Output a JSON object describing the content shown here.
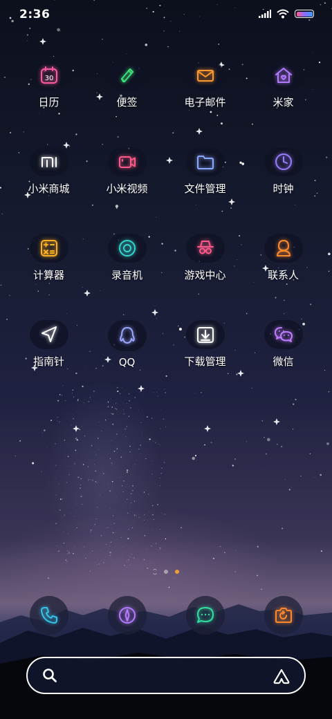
{
  "status_bar": {
    "time": "2:36",
    "battery_level": 1.0
  },
  "apps": [
    {
      "label": "日历",
      "icon": "calendar-icon",
      "icon_text": "30",
      "color": "#ff5aa0"
    },
    {
      "label": "便签",
      "icon": "note-pen-icon",
      "color": "#3fe07a"
    },
    {
      "label": "电子邮件",
      "icon": "mail-icon",
      "color": "#ff9a2e"
    },
    {
      "label": "米家",
      "icon": "home-icon",
      "color": "#b57bff"
    },
    {
      "label": "小米商城",
      "icon": "mi-logo-icon",
      "color": "#ffffff"
    },
    {
      "label": "小米视频",
      "icon": "video-camera-icon",
      "color": "#ff5a8a"
    },
    {
      "label": "文件管理",
      "icon": "folder-icon",
      "color": "#8aa8ff"
    },
    {
      "label": "时钟",
      "icon": "clock-icon",
      "color": "#9a7cff"
    },
    {
      "label": "计算器",
      "icon": "calculator-icon",
      "color": "#ffb020"
    },
    {
      "label": "录音机",
      "icon": "record-icon",
      "color": "#37d6d0"
    },
    {
      "label": "游戏中心",
      "icon": "game-center-icon",
      "color": "#ff5a8a"
    },
    {
      "label": "联系人",
      "icon": "contacts-icon",
      "color": "#ff8a2e"
    },
    {
      "label": "指南针",
      "icon": "compass-arrow-icon",
      "color": "#ffffff"
    },
    {
      "label": "QQ",
      "icon": "qq-penguin-icon",
      "color": "#9aa8ff"
    },
    {
      "label": "下载管理",
      "icon": "download-icon",
      "color": "#ffffff"
    },
    {
      "label": "微信",
      "icon": "wechat-icon",
      "color": "#c07cff"
    }
  ],
  "dock": [
    {
      "icon": "phone-icon",
      "color": "#35c3e8"
    },
    {
      "icon": "browser-compass-icon",
      "color": "#b57bff"
    },
    {
      "icon": "messages-icon",
      "color": "#2fe0a0"
    },
    {
      "icon": "camera-icon",
      "color": "#ff8a2e"
    }
  ],
  "page_indicator": {
    "pages": 2,
    "active_page": 2
  },
  "search": {
    "value": "",
    "placeholder": ""
  }
}
